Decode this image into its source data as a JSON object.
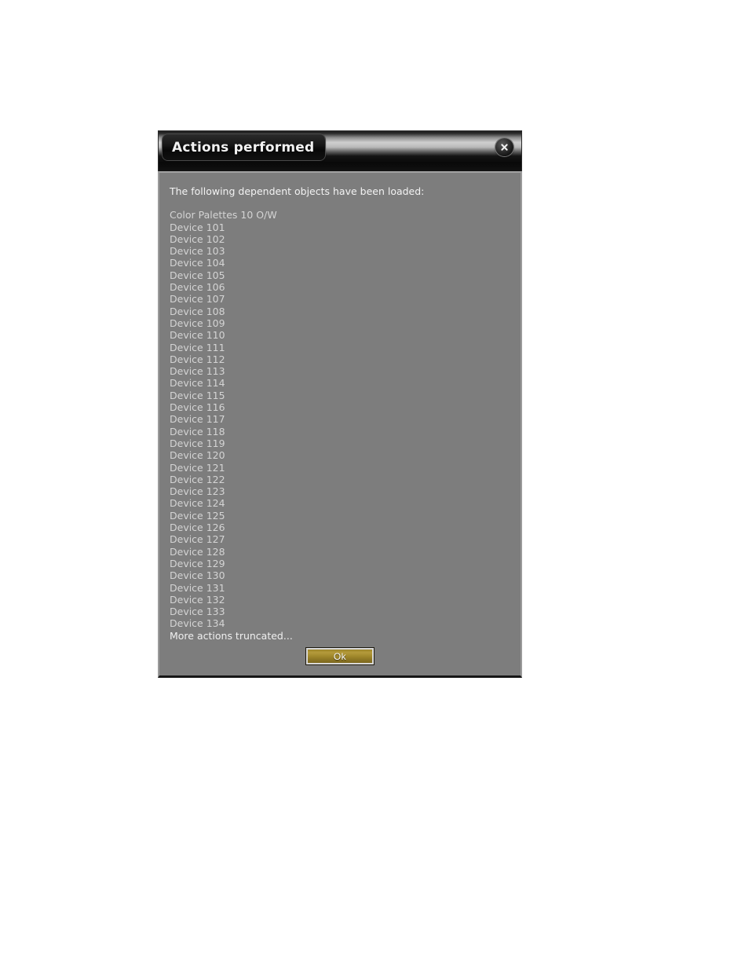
{
  "dialog": {
    "title": "Actions performed",
    "close_icon": "close-circle-icon",
    "message": "The following dependent objects have been loaded:",
    "items": [
      "Color Palettes 10 O/W",
      "Device 101",
      "Device 102",
      "Device 103",
      "Device 104",
      "Device 105",
      "Device 106",
      "Device 107",
      "Device 108",
      "Device 109",
      "Device 110",
      "Device 111",
      "Device 112",
      "Device 113",
      "Device 114",
      "Device 115",
      "Device 116",
      "Device 117",
      "Device 118",
      "Device 119",
      "Device 120",
      "Device 121",
      "Device 122",
      "Device 123",
      "Device 124",
      "Device 125",
      "Device 126",
      "Device 127",
      "Device 128",
      "Device 129",
      "Device 130",
      "Device 131",
      "Device 132",
      "Device 133",
      "Device 134"
    ],
    "truncated_note": "More actions truncated...",
    "ok_label": "Ok",
    "colors": {
      "body_background": "#7d7d7d",
      "body_border": "#9b9b9b",
      "titlebar_dark": "#0a0a0a",
      "titlebar_highlight": "#cfcfcf",
      "title_text": "#f2f2f2",
      "message_text": "#f3f3f3",
      "item_text": "#d4d4d4",
      "ok_button_fill": "#9d8529",
      "ok_button_border": "#d9d9d9",
      "ok_button_text": "#fdfdfd"
    }
  }
}
